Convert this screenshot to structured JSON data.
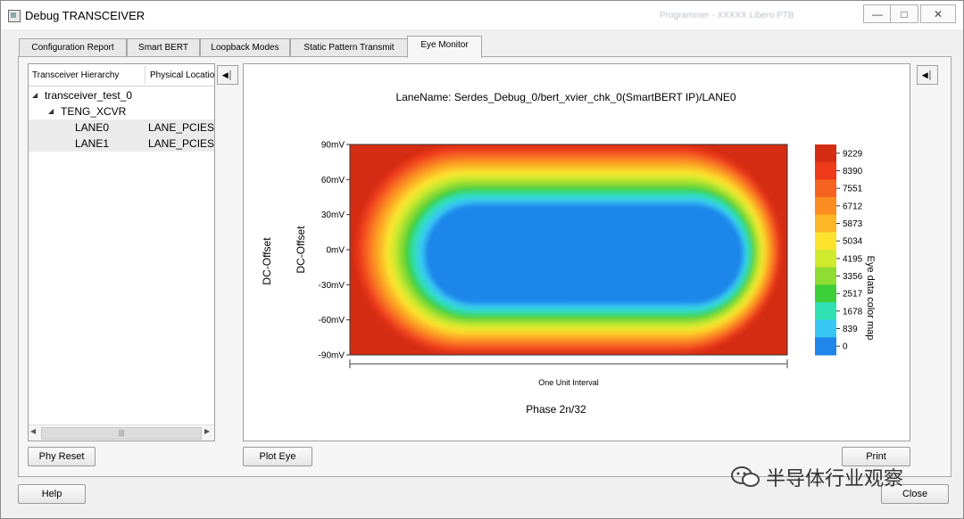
{
  "window": {
    "title": "Debug TRANSCEIVER",
    "ghost_text": "Programmer - XXXXX  Libero PTB"
  },
  "tabs": [
    {
      "label": "Configuration Report"
    },
    {
      "label": "Smart BERT"
    },
    {
      "label": "Loopback Modes"
    },
    {
      "label": "Static Pattern Transmit"
    },
    {
      "label": "Eye Monitor",
      "active": true
    }
  ],
  "tree": {
    "columns": [
      "Transceiver Hierarchy",
      "Physical Locatio"
    ],
    "rows": [
      {
        "label": "transceiver_test_0",
        "location": "",
        "expanded": true
      },
      {
        "label": "TENG_XCVR",
        "location": "",
        "expanded": true
      },
      {
        "label": "LANE0",
        "location": "LANE_PCIESS_"
      },
      {
        "label": "LANE1",
        "location": "LANE_PCIESS_"
      }
    ]
  },
  "buttons": {
    "phy_reset": "Phy Reset",
    "plot_eye": "Plot Eye",
    "print": "Print",
    "help": "Help",
    "close": "Close"
  },
  "chart_data": {
    "type": "heatmap",
    "title": "LaneName: Serdes_Debug_0/bert_xvier_chk_0(SmartBERT IP)/LANE0",
    "ylabel": "DC-Offset",
    "ylabel_outer": "DC-Offset",
    "xlabel": "One Unit Interval",
    "x_caption": "Phase 2n/32",
    "y_ticks": [
      "90mV",
      "60mV",
      "30mV",
      "0mV",
      "-30mV",
      "-60mV",
      "-90mV"
    ],
    "ylim_mv": [
      -90,
      90
    ],
    "colorbar": {
      "label": "Eye data color map",
      "ticks": [
        9229,
        8390,
        7551,
        6712,
        5873,
        5034,
        4195,
        3356,
        2517,
        1678,
        839,
        0
      ],
      "colors": [
        "#d42d14",
        "#ee3a1a",
        "#f66220",
        "#fb8d22",
        "#fcb626",
        "#fde22e",
        "#d0ea2e",
        "#8fdc32",
        "#3dcf3a",
        "#2fe0b3",
        "#37c8f4",
        "#1f86ea"
      ],
      "colormap": "jet"
    },
    "eye_opening": {
      "level_range": [
        0,
        839
      ],
      "x_range_ui": [
        0.17,
        0.9
      ],
      "y_range_mv": [
        -55,
        45
      ]
    }
  },
  "watermark": {
    "text": "半导体行业观察",
    "icon": "wechat-icon"
  }
}
